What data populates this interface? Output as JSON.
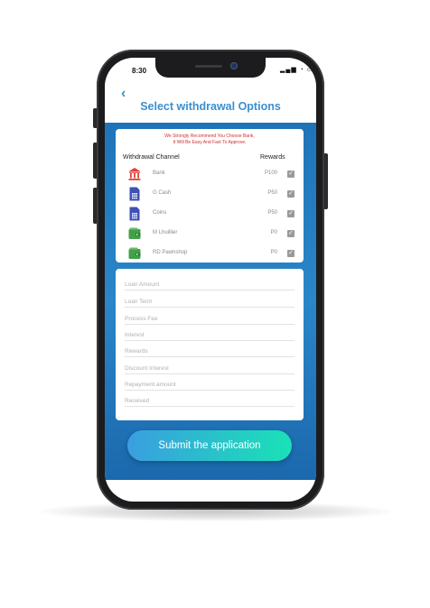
{
  "status_bar": {
    "time": "8:30",
    "icons": "▂▄▆ ◔ ▭"
  },
  "header": {
    "back_icon": "‹",
    "title": "Select withdrawal Options"
  },
  "channels": {
    "notice_line1": "We Strongly Recommend You Choose Bank,",
    "notice_line2": "It Will Be Easy And Fast To Approve.",
    "col_channel": "Withdrawal Channel",
    "col_rewards": "Rewards",
    "items": [
      {
        "name": "Bank",
        "reward": "P100",
        "icon": "bank-icon",
        "checked": true
      },
      {
        "name": "G Cash",
        "reward": "P50",
        "icon": "sim-card-icon",
        "checked": true
      },
      {
        "name": "Coins",
        "reward": "P50",
        "icon": "sim-card-icon",
        "checked": true
      },
      {
        "name": "M Lhuillier",
        "reward": "P0",
        "icon": "wallet-icon",
        "checked": true
      },
      {
        "name": "RD Pawnshop",
        "reward": "P0",
        "icon": "wallet-icon",
        "checked": true
      }
    ]
  },
  "form": {
    "fields": [
      {
        "placeholder": "Loan Amount",
        "value": ""
      },
      {
        "placeholder": "Loan Term",
        "value": ""
      },
      {
        "placeholder": "Process Fee",
        "value": ""
      },
      {
        "placeholder": "Interest",
        "value": ""
      },
      {
        "placeholder": "Rewards",
        "value": ""
      },
      {
        "placeholder": "Discount Interest",
        "value": ""
      },
      {
        "placeholder": "Repayment amount",
        "value": ""
      },
      {
        "placeholder": "Received",
        "value": ""
      }
    ]
  },
  "submit_label": "Submit the application",
  "colors": {
    "accent": "#3b8fcf",
    "notice": "#d32f2f",
    "bank_icon": "#e0413a",
    "sim_icon": "#3f51b5",
    "wallet_icon": "#43a047",
    "button_start": "#3a9ee0",
    "button_end": "#19e2b6"
  }
}
